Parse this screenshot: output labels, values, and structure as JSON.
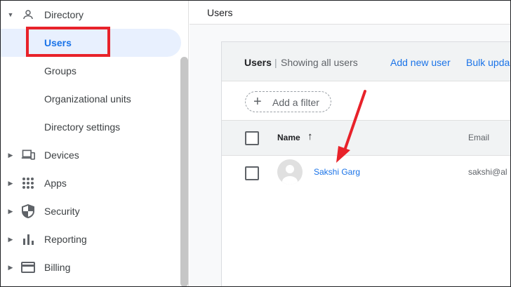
{
  "sidebar": {
    "section": {
      "label": "Directory",
      "icon": "person-icon"
    },
    "items": [
      {
        "label": "Users",
        "selected": true
      },
      {
        "label": "Groups"
      },
      {
        "label": "Organizational units"
      },
      {
        "label": "Directory settings"
      }
    ],
    "groups": [
      {
        "label": "Devices",
        "icon": "devices-icon"
      },
      {
        "label": "Apps",
        "icon": "apps-grid-icon"
      },
      {
        "label": "Security",
        "icon": "shield-icon"
      },
      {
        "label": "Reporting",
        "icon": "bar-chart-icon"
      },
      {
        "label": "Billing",
        "icon": "credit-card-icon"
      }
    ]
  },
  "main": {
    "breadcrumb": "Users",
    "card": {
      "title": "Users",
      "separator": "|",
      "subtitle": "Showing all users",
      "actions": [
        "Add new user",
        "Bulk upda"
      ],
      "filter_label": "Add a filter"
    },
    "table": {
      "columns": [
        "Name",
        "Email"
      ],
      "rows": [
        {
          "name": "Sakshi Garg",
          "email": "sakshi@al"
        }
      ]
    }
  },
  "colors": {
    "accent": "#1a73e8",
    "selected_bg": "#e8f0fe",
    "highlight_red": "#e8222a"
  }
}
